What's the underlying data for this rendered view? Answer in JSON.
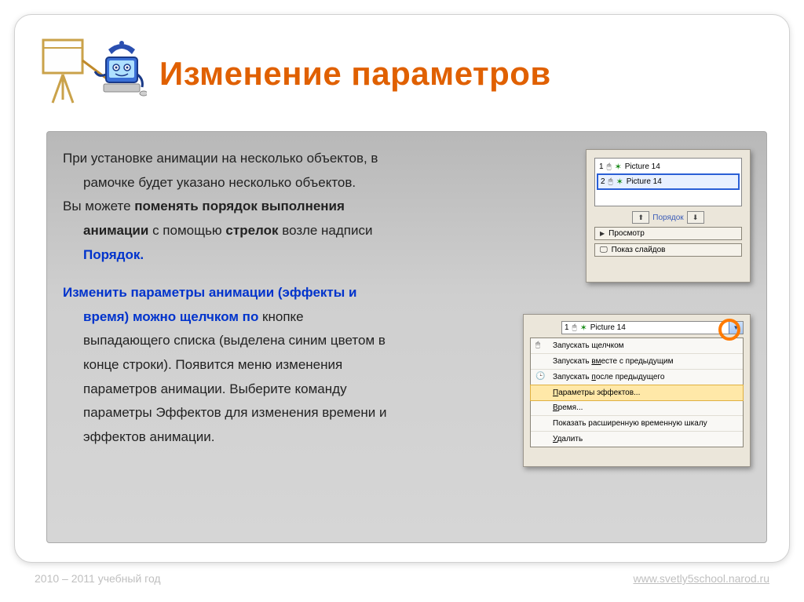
{
  "title": "Изменение параметров",
  "body": {
    "p1a": "При установке анимации на несколько объектов, в",
    "p1b": "рамочке будет указано несколько объектов.",
    "p2a": "Вы можете ",
    "p2b": "поменять порядок выполнения",
    "p2c": "анимации",
    "p2d": " с помощью ",
    "p2e": "стрелок",
    "p2f": " возле надписи",
    "p2g": "Порядок.",
    "p3a": "Изменить параметры анимации (эффекты и",
    "p3b": "время) можно щелчком по",
    "p3c": " кнопке",
    "p3d": "выпадающего списка (выделена синим цветом в",
    "p3e": "конце строки). Появится меню изменения",
    "p3f": "параметров анимации. Выберите команду",
    "p3g": "параметры Эффектов для изменения времени и",
    "p3h": "эффектов анимации."
  },
  "panel1": {
    "row1_num": "1",
    "row1_label": "Picture 14",
    "row2_num": "2",
    "row2_label": "Picture 14",
    "order_label": "Порядок",
    "preview_label": "Просмотр",
    "slideshow_label": "Показ слайдов"
  },
  "panel2": {
    "top_num": "1",
    "top_label": "Picture 14",
    "menu": {
      "m1": "Запускать щелчком",
      "m2_a": "Запускать ",
      "m2_b": "вм",
      "m2_c": "есте с предыдущим",
      "m3_a": "Запускать ",
      "m3_b": "п",
      "m3_c": "осле предыдущего",
      "m4_a": "П",
      "m4_b": "араметры эффектов...",
      "m5_a": "В",
      "m5_b": "ремя...",
      "m6": "Показать расширенную временную шкалу",
      "m7_a": "У",
      "m7_b": "далить"
    }
  },
  "footer": {
    "left": "2010 – 2011 учебный год",
    "right": "www.svetly5school.narod.ru"
  }
}
